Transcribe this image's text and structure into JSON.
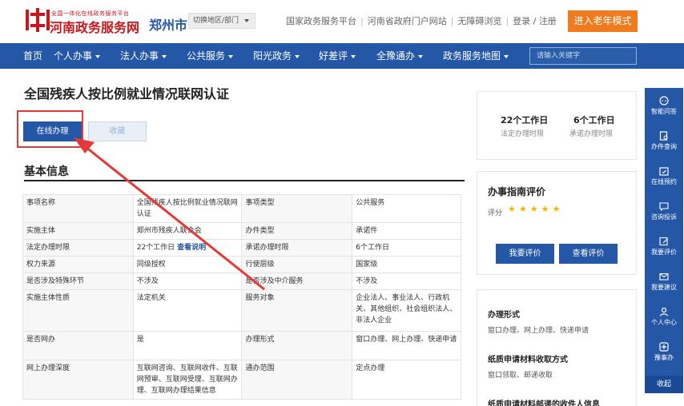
{
  "header": {
    "logo_subtitle": "全国一体化在线政务服务平台",
    "logo_title": "河南政务服务网",
    "city": "郑州市",
    "region_switch": "切换地区/部门",
    "links": [
      "国家政务服务平台",
      "河南省政府门户网站",
      "无障碍浏览",
      "登录 / 注册"
    ],
    "elder_mode": "进入老年模式"
  },
  "nav": {
    "items": [
      {
        "label": "首页",
        "dropdown": false
      },
      {
        "label": "个人办事",
        "dropdown": true
      },
      {
        "label": "法人办事",
        "dropdown": true
      },
      {
        "label": "公共服务",
        "dropdown": true
      },
      {
        "label": "阳光政务",
        "dropdown": true
      },
      {
        "label": "好差评",
        "dropdown": true
      },
      {
        "label": "全豫通办",
        "dropdown": true
      },
      {
        "label": "政务服务地图",
        "dropdown": true
      }
    ],
    "search_placeholder": "请输入关键字"
  },
  "page": {
    "title": "全国残疾人按比例就业情况联网认证",
    "online_button": "在线办理",
    "favorite_button": "收藏",
    "section_title": "基本信息"
  },
  "info_rows": [
    {
      "k1": "事项名称",
      "v1": "全国残疾人按比例就业情况联网认证",
      "k2": "事项类型",
      "v2": "公共服务"
    },
    {
      "k1": "实施主体",
      "v1": "郑州市残疾人联合会",
      "k2": "办件类型",
      "v2": "承诺件"
    },
    {
      "k1": "法定办理时限",
      "v1": "22个工作日",
      "v1_link": "查看说明",
      "k2": "承诺办理时限",
      "v2": "6个工作日"
    },
    {
      "k1": "权力来源",
      "v1": "同级授权",
      "k2": "行使层级",
      "v2": "国家级"
    },
    {
      "k1": "是否涉及特殊环节",
      "v1": "不涉及",
      "k2": "是否涉及中介服务",
      "v2": "不涉及"
    },
    {
      "k1": "实施主体性质",
      "v1": "法定机关",
      "k2": "服务对象",
      "v2": "企业法人、事业法人、行政机关、其他组织、社会组织法人、非法人企业"
    },
    {
      "k1": "是否网办",
      "v1": "是",
      "k2": "办理形式",
      "v2": "窗口办理、网上办理、快递申请"
    },
    {
      "k1": "网上办理深度",
      "v1": "互联网咨询、互联网收件、互联网预审、互联网受理、互联网办理、互联网办理结果信息",
      "k2": "通办范围",
      "v2": "定点办理"
    }
  ],
  "time_card": {
    "legal_value": "22个工作日",
    "legal_label": "法定办理时限",
    "promise_value": "6个工作日",
    "promise_label": "承诺办理时限"
  },
  "evaluation": {
    "title": "办事指南评价",
    "score_label": "评分",
    "stars": "★★★★★",
    "rate_button": "我要评价",
    "view_button": "查看评价"
  },
  "side_info": [
    {
      "title": "办理形式",
      "value": "窗口办理、网上办理、快递申请"
    },
    {
      "title": "纸质申请材料收取方式",
      "value": "窗口领取、邮递收取"
    },
    {
      "title": "纸质申请材料邮递的收件人信息",
      "value": ""
    }
  ],
  "float_bar": {
    "items": [
      "智能问答",
      "办件查询",
      "在线预约",
      "咨询投诉",
      "我要评价",
      "我要建议",
      "个人中心",
      "豫事办"
    ],
    "fold": "收起"
  },
  "colors": {
    "brand_blue": "#2457a5",
    "brand_red": "#c8161d",
    "accent_orange": "#f07b1e",
    "annotation_red": "#e53935",
    "star": "#f5b400"
  }
}
